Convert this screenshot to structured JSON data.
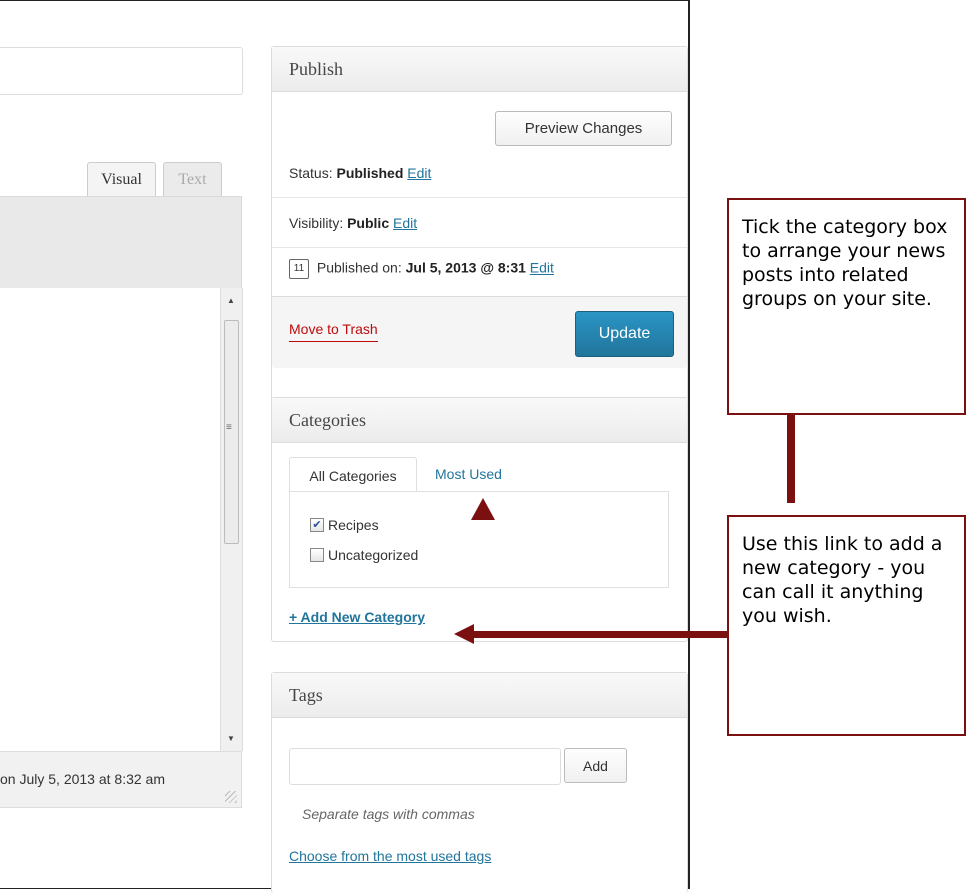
{
  "editor": {
    "tab_visual": "Visual",
    "tab_text": "Text",
    "last_edited": "on July 5, 2013 at 8:32 am"
  },
  "publish": {
    "title": "Publish",
    "preview_label": "Preview Changes",
    "status_label": "Status:",
    "status_value": "Published",
    "visibility_label": "Visibility:",
    "visibility_value": "Public",
    "published_label": "Published on:",
    "published_value": "Jul 5, 2013 @ 8:31",
    "calendar_day": "11",
    "edit_label": "Edit",
    "trash_label": "Move to Trash",
    "update_label": "Update"
  },
  "categories": {
    "title": "Categories",
    "tab_all": "All Categories",
    "tab_most_used": "Most Used",
    "items": [
      {
        "label": "Recipes",
        "checked": true
      },
      {
        "label": "Uncategorized",
        "checked": false
      }
    ],
    "add_new_label": "+ Add New Category"
  },
  "tags": {
    "title": "Tags",
    "input_value": "",
    "add_label": "Add",
    "hint": "Separate tags with commas",
    "choose_label": "Choose from the most used tags"
  },
  "callouts": {
    "category_box": "Tick the category box to arrange your news posts into related groups on your site.",
    "add_link": "Use this link to add a new category - you can call it anything you wish."
  },
  "colors": {
    "link": "#21759b",
    "primary_button": "#21759b",
    "trash": "#bc0b0b",
    "callout_border": "#7b1010"
  },
  "icons": {
    "calendar": "calendar-icon",
    "check": "checkbox-checked-icon"
  }
}
